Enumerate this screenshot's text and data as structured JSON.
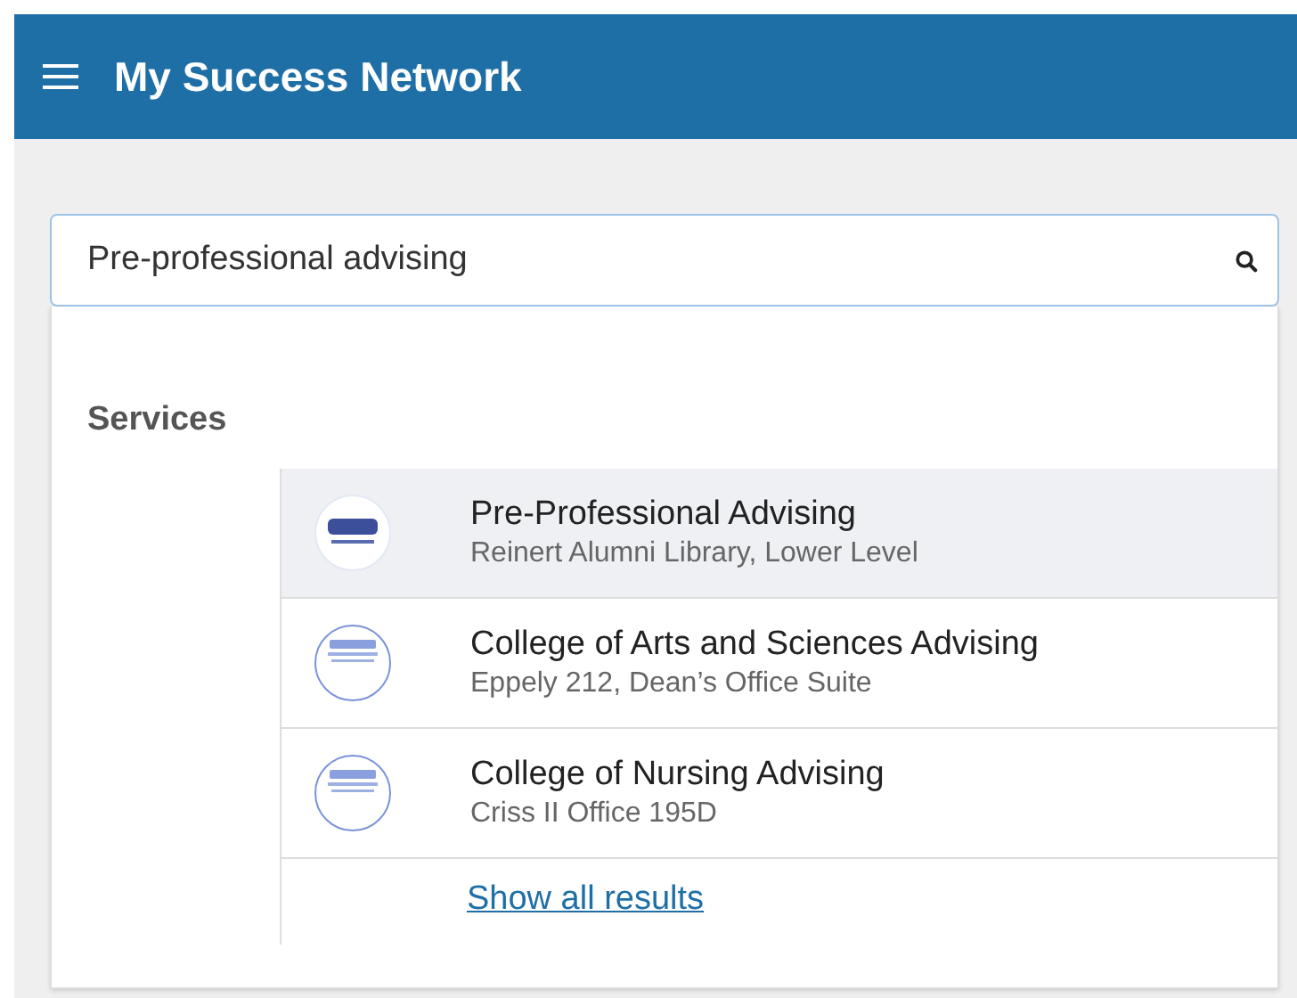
{
  "header": {
    "title": "My Success Network"
  },
  "search": {
    "value": "Pre-professional advising"
  },
  "results": {
    "section_title": "Services",
    "items": [
      {
        "name": "Pre-Professional Advising",
        "location": "Reinert Alumni Library, Lower Level",
        "selected": true
      },
      {
        "name": "College of Arts and Sciences Advising",
        "location": "Eppely 212, Dean’s Office Suite",
        "selected": false
      },
      {
        "name": "College of Nursing Advising",
        "location": "Criss II Office 195D",
        "selected": false
      }
    ],
    "show_all": "Show all results"
  }
}
